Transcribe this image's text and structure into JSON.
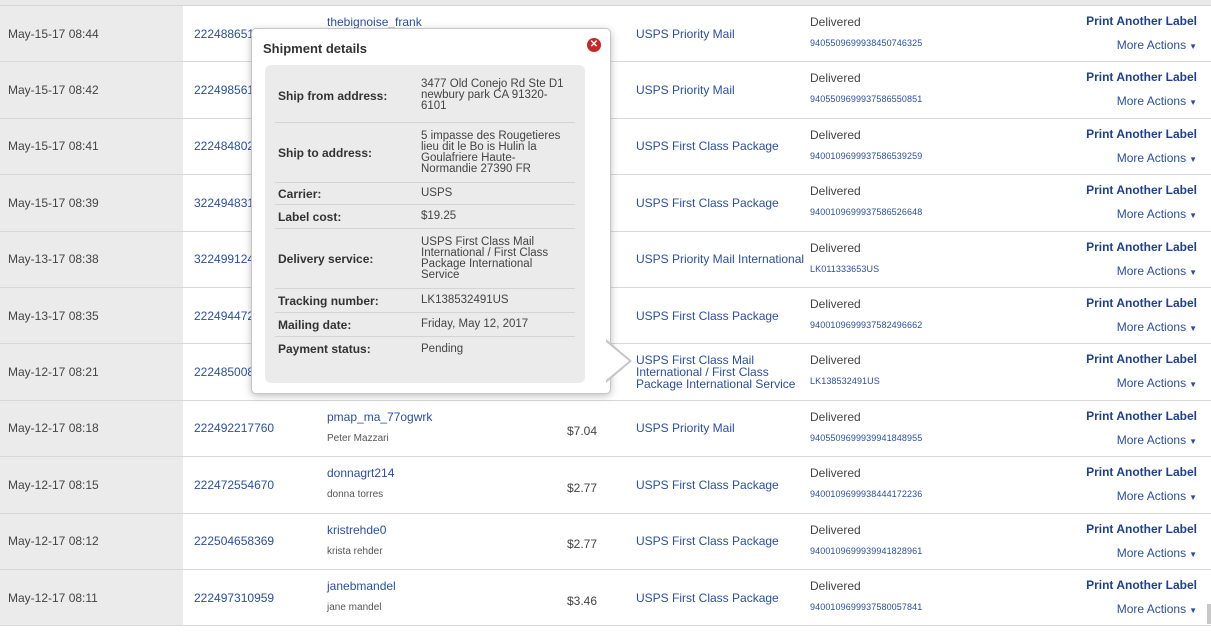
{
  "shipments": [
    {
      "date": "May-15-17 08:44",
      "order": "222488651180",
      "user": "thebignoise_frank",
      "name": "",
      "cost": "",
      "service": "USPS Priority Mail",
      "status": "Delivered",
      "tracking": "9405509699938450746325",
      "print": "Print Another Label",
      "more": "More Actions"
    },
    {
      "date": "May-15-17 08:42",
      "order": "222498561",
      "user": "",
      "name": "",
      "cost": "",
      "service": "USPS Priority Mail",
      "status": "Delivered",
      "tracking": "9405509699937586550851",
      "print": "Print Another Label",
      "more": "More Actions"
    },
    {
      "date": "May-15-17 08:41",
      "order": "222484802",
      "user": "",
      "name": "",
      "cost": "",
      "service": "USPS First Class Package",
      "status": "Delivered",
      "tracking": "9400109699937586539259",
      "print": "Print Another Label",
      "more": "More Actions"
    },
    {
      "date": "May-15-17 08:39",
      "order": "322494831",
      "user": "",
      "name": "",
      "cost": "",
      "service": "USPS First Class Package",
      "status": "Delivered",
      "tracking": "9400109699937586526648",
      "print": "Print Another Label",
      "more": "More Actions"
    },
    {
      "date": "May-13-17 08:38",
      "order": "322499124",
      "user": "",
      "name": "",
      "cost": "",
      "service": "USPS Priority Mail International",
      "status": "Delivered",
      "tracking": "LK011333653US",
      "print": "Print Another Label",
      "more": "More Actions"
    },
    {
      "date": "May-13-17 08:35",
      "order": "222494472",
      "user": "",
      "name": "",
      "cost": "",
      "service": "USPS First Class Package",
      "status": "Delivered",
      "tracking": "9400109699937582496662",
      "print": "Print Another Label",
      "more": "More Actions"
    },
    {
      "date": "May-12-17 08:21",
      "order": "222485008",
      "user": "",
      "name": "",
      "cost": "",
      "service": "USPS First Class Mail International / First Class Package International Service",
      "status": "Delivered",
      "tracking": "LK138532491US",
      "print": "Print Another Label",
      "more": "More Actions"
    },
    {
      "date": "May-12-17 08:18",
      "order": "222492217760",
      "user": "pmap_ma_77ogwrk",
      "name": "Peter Mazzari",
      "cost": "$7.04",
      "service": "USPS Priority Mail",
      "status": "Delivered",
      "tracking": "9405509699939941848955",
      "print": "Print Another Label",
      "more": "More Actions"
    },
    {
      "date": "May-12-17 08:15",
      "order": "222472554670",
      "user": "donnagrt214",
      "name": "donna torres",
      "cost": "$2.77",
      "service": "USPS First Class Package",
      "status": "Delivered",
      "tracking": "9400109699938444172236",
      "print": "Print Another Label",
      "more": "More Actions"
    },
    {
      "date": "May-12-17 08:12",
      "order": "222504658369",
      "user": "kristrehde0",
      "name": "krista rehder",
      "cost": "$2.77",
      "service": "USPS First Class Package",
      "status": "Delivered",
      "tracking": "9400109699939941828961",
      "print": "Print Another Label",
      "more": "More Actions"
    },
    {
      "date": "May-12-17 08:11",
      "order": "222497310959",
      "user": "janebmandel",
      "name": "jane mandel",
      "cost": "$3.46",
      "service": "USPS First Class Package",
      "status": "Delivered",
      "tracking": "9400109699937580057841",
      "print": "Print Another Label",
      "more": "More Actions"
    }
  ],
  "popup": {
    "title": "Shipment details",
    "close_icon": "close-circle-icon",
    "rows": [
      {
        "label": "Ship from address:",
        "value": "3477 Old Conejo Rd Ste D1 newbury park CA 91320-6101"
      },
      {
        "label": "Ship to address:",
        "value": "5 impasse des Rougetieres lieu dit le Bo is Hulin la Goulafriere Haute-Normandie 27390 FR"
      },
      {
        "label": "Carrier:",
        "value": "USPS"
      },
      {
        "label": "Label cost:",
        "value": "$19.25"
      },
      {
        "label": "Delivery service:",
        "value": "USPS First Class Mail International / First Class Package International Service"
      },
      {
        "label": "Tracking number:",
        "value": "LK138532491US"
      },
      {
        "label": "Mailing date:",
        "value": "Friday, May 12, 2017"
      },
      {
        "label": "Payment status:",
        "value": "Pending"
      }
    ]
  },
  "colors": {
    "link": "#2a4fa0",
    "date_bg": "#ebebeb",
    "close": "#c62828"
  }
}
